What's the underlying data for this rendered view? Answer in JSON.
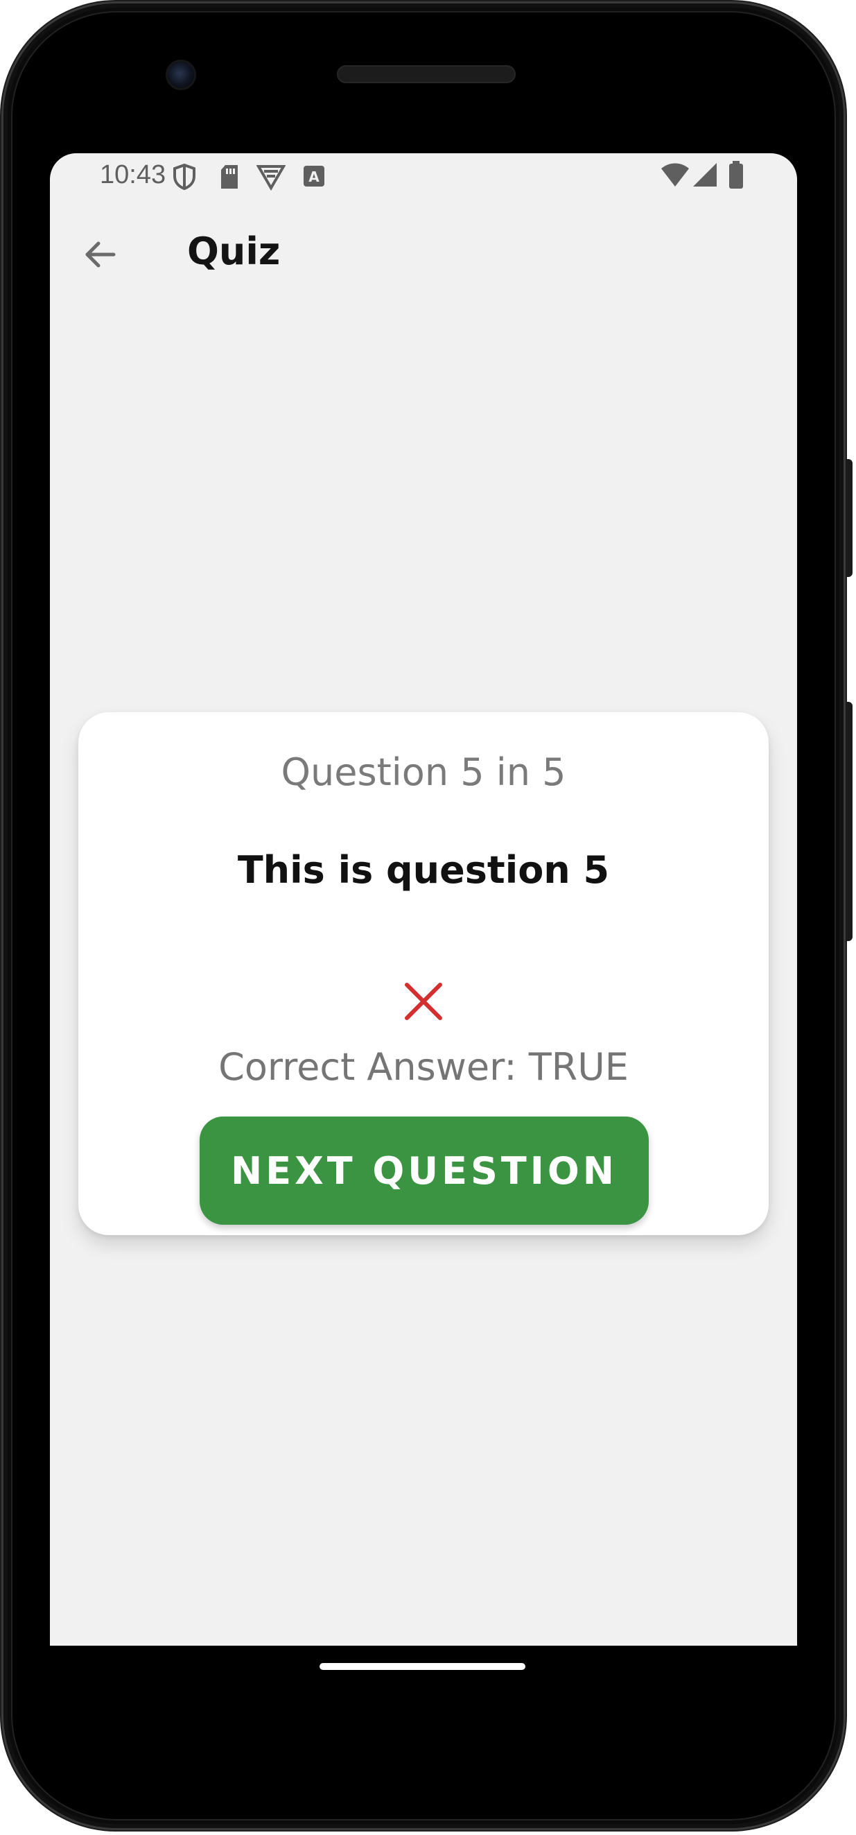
{
  "status_bar": {
    "time": "10:43",
    "left_icons": [
      "shield-icon",
      "sd-card-icon",
      "vpn-icon",
      "keyboard-a-icon"
    ],
    "right_icons": [
      "wifi-icon",
      "signal-icon",
      "battery-icon"
    ]
  },
  "app_bar": {
    "back_icon": "arrow-left-icon",
    "title": "Quiz"
  },
  "quiz_card": {
    "counter": "Question 5 in 5",
    "question": "This is question 5",
    "result_icon": "close-x-icon",
    "result_color": "#d32f2f",
    "correct_answer": "Correct Answer: TRUE",
    "next_button_label": "NEXT QUESTION",
    "next_button_color": "#3a9441"
  }
}
